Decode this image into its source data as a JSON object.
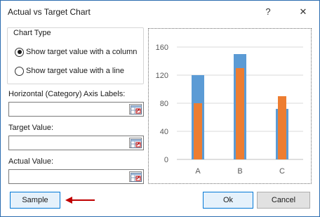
{
  "window": {
    "title": "Actual vs Target Chart",
    "help_glyph": "?",
    "close_glyph": "✕"
  },
  "chart_type_group": {
    "legend": "Chart Type",
    "options": [
      {
        "label": "Show target value with a column",
        "selected": true
      },
      {
        "label": "Show target value with a line",
        "selected": false
      }
    ]
  },
  "fields": {
    "axis_labels": {
      "label": "Horizontal (Category) Axis Labels:",
      "value": ""
    },
    "target_value": {
      "label": "Target Value:",
      "value": ""
    },
    "actual_value": {
      "label": "Actual Value:",
      "value": ""
    }
  },
  "buttons": {
    "sample": "Sample",
    "ok": "Ok",
    "cancel": "Cancel"
  },
  "colors": {
    "target": "#5b9bd5",
    "actual": "#ed7d31",
    "annotation_arrow": "#c00000"
  },
  "chart_data": {
    "type": "bar",
    "categories": [
      "A",
      "B",
      "C"
    ],
    "series": [
      {
        "values": [
          120,
          150,
          72
        ]
      },
      {
        "values": [
          80,
          130,
          90
        ]
      }
    ],
    "ylim": [
      0,
      160
    ],
    "yticks": [
      0,
      40,
      80,
      120,
      160
    ],
    "grid": true,
    "legend": "none"
  }
}
